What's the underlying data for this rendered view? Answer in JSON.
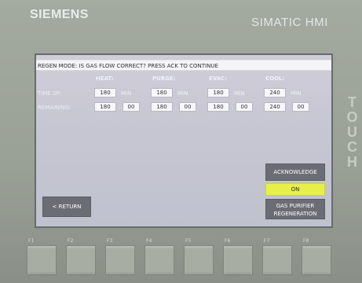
{
  "device": {
    "brand": "SIEMENS",
    "model": "SIMATIC HMI",
    "touch_label": "TOUCH"
  },
  "screen": {
    "banner": "REGEN MODE: IS GAS FLOW CORRECT? PRESS ACK TO CONTINUE",
    "headers": [
      "HEAT:",
      "PURGE:",
      "EVAC:",
      "COOL:"
    ],
    "row_labels": {
      "time_sp": "TIME SP:",
      "remaining": "REMAINING:"
    },
    "time_sp": [
      {
        "value": "180",
        "unit": "MIN"
      },
      {
        "value": "180",
        "unit": "MIN"
      },
      {
        "value": "180",
        "unit": "MIN"
      },
      {
        "value": "240",
        "unit": "MIN"
      }
    ],
    "remaining": [
      {
        "min": "180",
        "sec": "00"
      },
      {
        "min": "180",
        "sec": "00"
      },
      {
        "min": "180",
        "sec": "00"
      },
      {
        "min": "240",
        "sec": "00"
      }
    ],
    "buttons": {
      "acknowledge": "ACKNOWLEDGE",
      "status": "ON",
      "gas_line1": "GAS PURIFIER",
      "gas_line2": "REGENERATION",
      "return": "< RETURN"
    }
  },
  "function_keys": [
    "F1",
    "F2",
    "F3",
    "F4",
    "F5",
    "F6",
    "F7",
    "F8"
  ]
}
